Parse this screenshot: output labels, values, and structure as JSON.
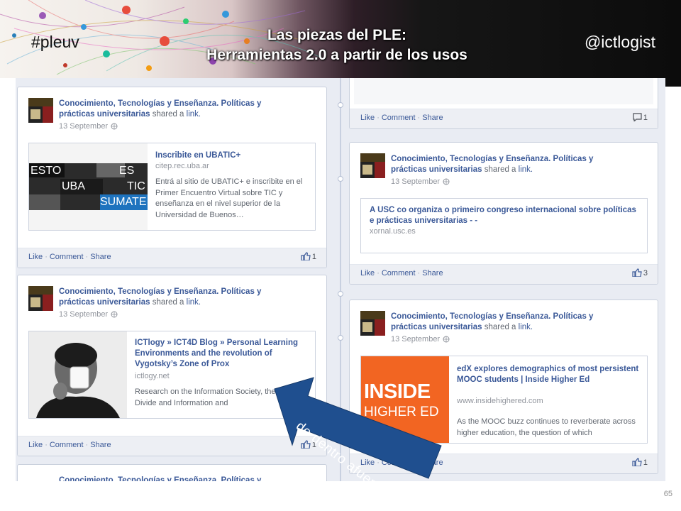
{
  "slide": {
    "hashtag": "#pleuv",
    "handle": "@ictlogist",
    "title_line1": "Las piezas del PLE:",
    "title_line2": "Herramientas 2.0 a partir de los usos",
    "page_number": "65",
    "arrow_label": "de dentro afuera"
  },
  "common": {
    "poster": "Conocimiento, Tecnologías y Enseñanza. Políticas y prácticas universitarias",
    "shared_a": "shared a",
    "link": "link.",
    "date": "13 September",
    "like": "Like",
    "comment": "Comment",
    "share": "Share",
    "dot": "·"
  },
  "posts": [
    {
      "title": "Inscribite en UBATIC+",
      "domain": "citep.rec.uba.ar",
      "description": "Entrá al sitio de UBATIC+ e inscribite en el Primer Encuentro Virtual sobre TIC y enseñanza en el nivel superior de la Universidad de Buenos…",
      "thumb_words": [
        "ESTO",
        "ES",
        "UBA",
        "TIC",
        "SUMATE"
      ],
      "likes": "1"
    },
    {
      "title": "A USC co organiza o primeiro congreso internacional sobre políticas e prácticas universitarias - -",
      "domain": "xornal.usc.es",
      "likes": "3"
    },
    {
      "title": "ICTlogy » ICT4D Blog » Personal Learning Environments and the revolution of Vygotsky’s Zone of Prox",
      "domain": "ictlogy.net",
      "description": "Research on the Information Society, the Digital Divide and Information and",
      "likes": "1"
    },
    {
      "title": "edX explores demographics of most persistent MOOC students | Inside Higher Ed",
      "domain": "www.insidehighered.com",
      "description": "As the MOOC buzz continues to reverberate across higher education, the question of which",
      "thumb_words": [
        "INSIDE",
        "HIGHER ED"
      ],
      "likes": "1"
    }
  ],
  "top_right_card": {
    "comments": "1"
  },
  "colors": {
    "fb_blue": "#3b5998",
    "timeline_bg": "#e9ecf3",
    "arrow_blue": "#1f4f8f",
    "inside_orange": "#f26522"
  }
}
